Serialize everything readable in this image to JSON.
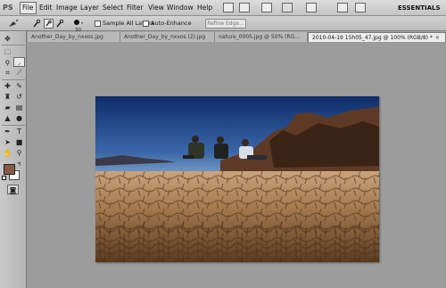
{
  "app": {
    "logo": "PS",
    "menu": [
      "File",
      "Edit",
      "Image",
      "Layer",
      "Select",
      "Filter",
      "View",
      "Window",
      "Help"
    ],
    "active_menu": "File",
    "workspace": "ESSENTIALS",
    "window_controls": [
      "–",
      "□",
      "✕"
    ]
  },
  "options": {
    "brush_size": "30",
    "sample_all_layers": "Sample All Layers",
    "auto_enhance": "Auto-Enhance",
    "refine_edge": "Refine Edge..."
  },
  "tabs": [
    {
      "label": "Another_Day_by_nxxos.jpg",
      "active": false
    },
    {
      "label": "Another_Day_by_nxxos (2).jpg",
      "active": false
    },
    {
      "label": "nature_0005.jpg @ 50% (RG...",
      "active": false
    },
    {
      "label": "2010-04-19 15h05_47.jpg @ 100% (RGB/8) *",
      "active": true
    }
  ],
  "tools": [
    "move-icon",
    "marquee-icon",
    "lasso-icon",
    "quick-selection-icon",
    "crop-icon",
    "eyedropper-icon",
    "healing-brush-icon",
    "brush-icon",
    "clone-stamp-icon",
    "history-brush-icon",
    "eraser-icon",
    "gradient-icon",
    "blur-icon",
    "dodge-icon",
    "pen-icon",
    "type-icon",
    "path-selection-icon",
    "shape-icon",
    "hand-icon",
    "zoom-icon"
  ],
  "colors": {
    "foreground": "#8a5a44",
    "background": "#ffffff"
  }
}
